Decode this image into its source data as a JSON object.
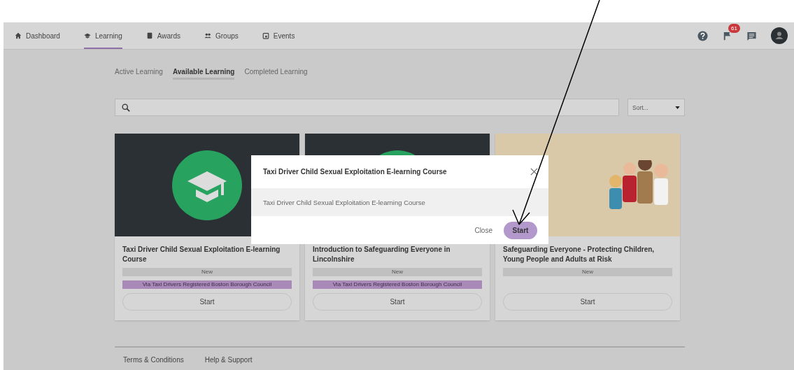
{
  "nav": {
    "items": [
      {
        "label": "Dashboard",
        "kind": "home",
        "selected": false
      },
      {
        "label": "Learning",
        "kind": "cap",
        "selected": true
      },
      {
        "label": "Awards",
        "kind": "book",
        "selected": false
      },
      {
        "label": "Groups",
        "kind": "people",
        "selected": false
      },
      {
        "label": "Events",
        "kind": "calendar",
        "selected": false
      }
    ],
    "notification_count": "61"
  },
  "subtabs": [
    {
      "label": "Active Learning",
      "selected": false
    },
    {
      "label": "Available Learning",
      "selected": true
    },
    {
      "label": "Completed Learning",
      "selected": false
    }
  ],
  "sort": {
    "value": "Sort..."
  },
  "cards": [
    {
      "title": "Taxi Driver Child Sexual Exploitation E-learning Course",
      "kind": "cap",
      "tags": [
        {
          "label": "New",
          "kind": "status"
        },
        {
          "label": "Via Taxi Drivers Registered Boston Borough Council",
          "kind": "source"
        }
      ],
      "button": "Start"
    },
    {
      "title": "Introduction to Safeguarding Everyone in Lincolnshire",
      "kind": "cap",
      "tags": [
        {
          "label": "New",
          "kind": "status"
        },
        {
          "label": "Via Taxi Drivers Registered Boston Borough Council",
          "kind": "source"
        }
      ],
      "button": "Start"
    },
    {
      "title": "Safeguarding Everyone - Protecting Children, Young People and Adults at Risk",
      "kind": "illustration",
      "tags": [
        {
          "label": "New",
          "kind": "status"
        }
      ],
      "button": "Start"
    }
  ],
  "modal": {
    "title": "Taxi Driver Child Sexual Exploitation E-learning Course",
    "body": "Taxi Driver Child Sexual Exploitation E-learning Course",
    "close_label": "Close",
    "start_label": "Start"
  },
  "footer": {
    "links": [
      "Terms & Conditions",
      "Help & Support"
    ]
  }
}
